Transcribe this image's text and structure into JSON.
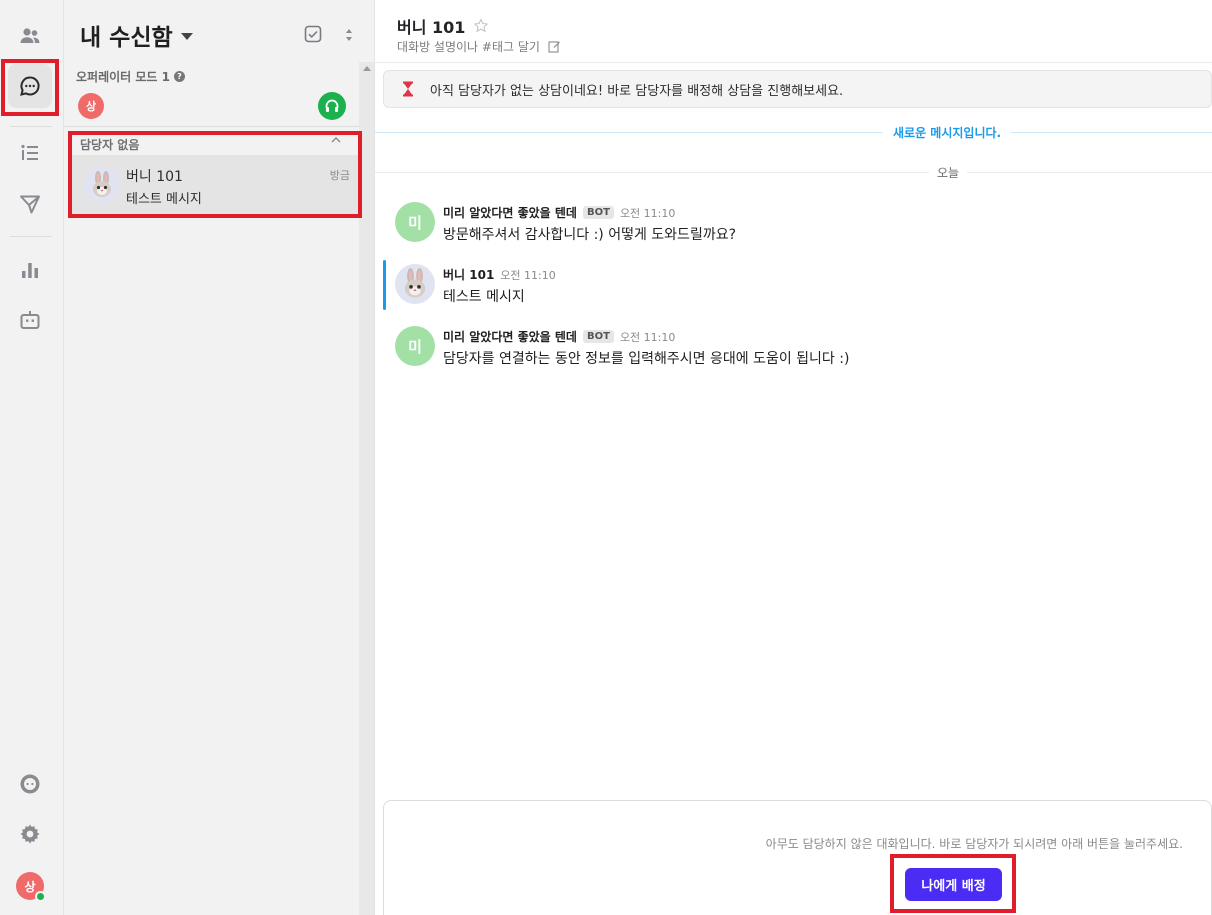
{
  "rail": {
    "avatar_initial": "상"
  },
  "inbox": {
    "title": "내 수신함",
    "operator_mode_label": "오퍼레이터 모드 1",
    "operator_mode_help": "?",
    "operator_avatar_initial": "상",
    "group_header": "담당자 없음",
    "conversation": {
      "name": "버니 101",
      "time": "방금",
      "preview": "테스트 메시지"
    }
  },
  "chat": {
    "title": "버니 101",
    "description": "대화방 설명이나 #태그 달기",
    "notice": "아직 담당자가 없는 상담이네요! 바로 담당자를 배정해 상담을 진행해보세요.",
    "new_messages_label": "새로운 메시지입니다.",
    "today_label": "오늘",
    "messages": [
      {
        "sender": "미리 알았다면 좋았을 텐데",
        "badge": "BOT",
        "time": "오전 11:10",
        "text": "방문해주셔서 감사합니다 :) 어떻게 도와드릴까요?",
        "avatar_initial": "미"
      },
      {
        "sender": "버니 101",
        "badge": "",
        "time": "오전 11:10",
        "text": "테스트 메시지",
        "avatar_initial": ""
      },
      {
        "sender": "미리 알았다면 좋았을 텐데",
        "badge": "BOT",
        "time": "오전 11:10",
        "text": "담당자를 연결하는 동안 정보를 입력해주시면 응대에 도움이 됩니다 :)",
        "avatar_initial": "미"
      }
    ]
  },
  "assign": {
    "text": "아무도 담당하지 않은 대화입니다. 바로 담당자가 되시려면 아래 버튼을 눌러주세요.",
    "button_label": "나에게 배정"
  },
  "colors": {
    "accent": "#4a2cf4",
    "new_message": "#1a9bea",
    "highlight": "#e01e2b",
    "online": "#1bb14e"
  },
  "icons": [
    "contacts-icon",
    "chat-inbox-icon",
    "list-icon",
    "send-icon",
    "chart-icon",
    "bot-icon",
    "help-chat-icon",
    "gear-icon",
    "headset-icon",
    "star-icon",
    "edit-icon",
    "hourglass-icon",
    "checkbox-icon",
    "sort-icon",
    "bunny-avatar"
  ]
}
